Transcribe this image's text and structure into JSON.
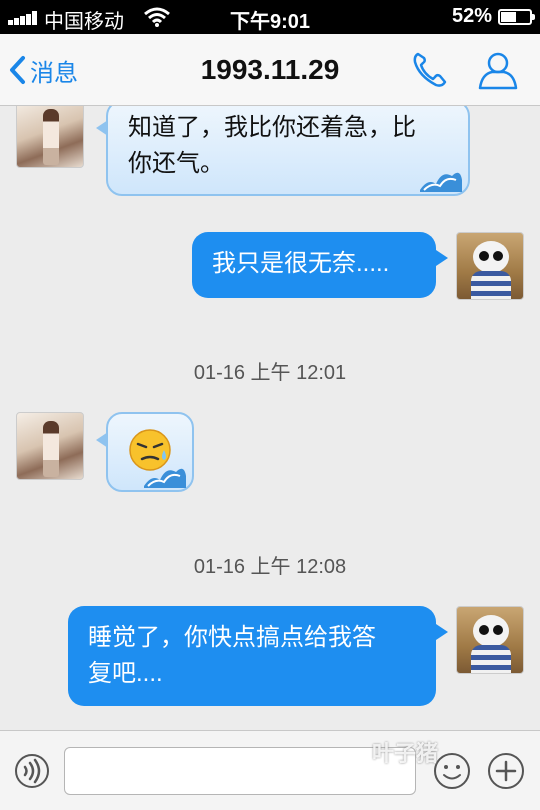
{
  "status_bar": {
    "carrier": "中国移动",
    "time": "下午9:01",
    "battery_percent": "52%",
    "battery_level": 0.52
  },
  "nav": {
    "back_label": "消息",
    "title": "1993.11.29",
    "icons": [
      "chevron-left-icon",
      "phone-icon",
      "profile-icon"
    ]
  },
  "messages": [
    {
      "direction": "incoming",
      "text_line1": "知道了，我比你还着急，比",
      "text_line2": "你还气。"
    },
    {
      "direction": "outgoing",
      "text": "我只是很无奈....."
    },
    {
      "type": "timestamp",
      "text": "01-16 上午 12:01"
    },
    {
      "direction": "incoming",
      "emoji": "sweat-sigh-emoji"
    },
    {
      "type": "timestamp",
      "text": "01-16 上午 12:08"
    },
    {
      "direction": "outgoing",
      "text_line1": "睡觉了，你快点搞点给我答",
      "text_line2": "复吧...."
    }
  ],
  "input_bar": {
    "placeholder": "",
    "icons": [
      "voice-icon",
      "emoji-icon",
      "plus-icon"
    ]
  },
  "watermark": "叶子猪",
  "colors": {
    "accent": "#1a86e8",
    "outgoing_bubble": "#1e8ef0",
    "incoming_bubble_border": "#8fc3ef"
  }
}
